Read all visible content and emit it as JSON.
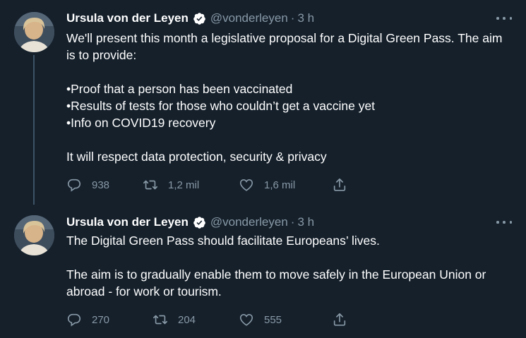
{
  "colors": {
    "background": "#15202b",
    "text": "#ffffff",
    "secondary": "#8899a6",
    "verified": "#ffffff"
  },
  "tweets": [
    {
      "name": "Ursula von der Leyen",
      "handle": "@vonderleyen",
      "separator": "·",
      "time": "3 h",
      "text": "We'll present this month a legislative proposal for a Digital Green Pass. The aim is to provide:\n\n•Proof that a person has been vaccinated\n•Results of tests for those who couldn’t get a vaccine yet\n•Info on COVID19 recovery\n\nIt will respect data protection, security & privacy",
      "replies": "938",
      "retweets": "1,2 mil",
      "likes": "1,6 mil"
    },
    {
      "name": "Ursula von der Leyen",
      "handle": "@vonderleyen",
      "separator": "·",
      "time": "3 h",
      "text": "The Digital Green Pass should facilitate Europeans’ lives.\n\nThe aim is to gradually enable them to move safely in the European Union or abroad - for work or tourism.",
      "replies": "270",
      "retweets": "204",
      "likes": "555"
    }
  ],
  "icons": [
    "verified-badge-icon",
    "more-options-icon",
    "reply-icon",
    "retweet-icon",
    "like-icon",
    "share-icon"
  ]
}
